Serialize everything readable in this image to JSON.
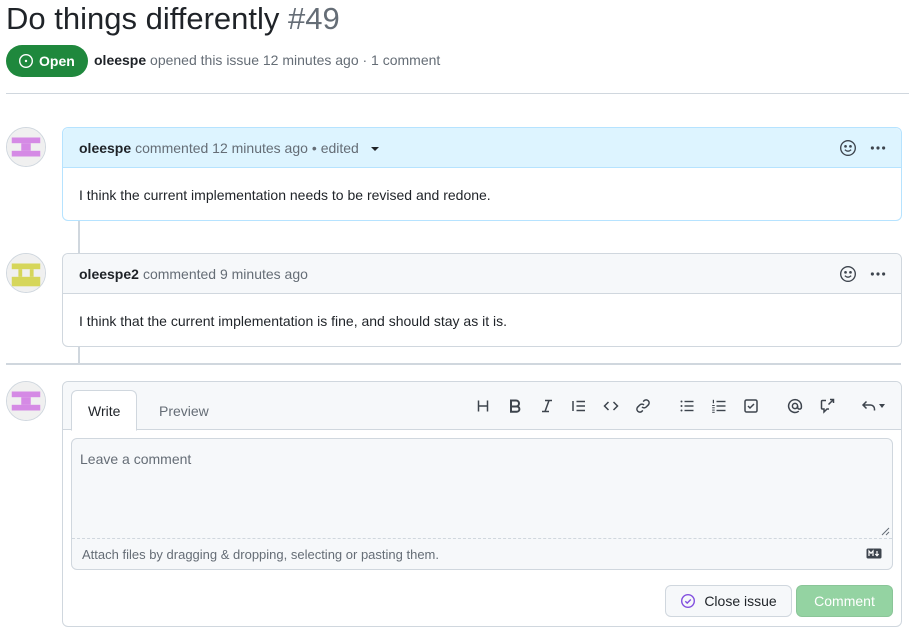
{
  "issue": {
    "title": "Do things differently",
    "number": "#49",
    "state": "Open",
    "author": "oleespe",
    "meta_text": "opened this issue 12 minutes ago · 1 comment"
  },
  "comments": [
    {
      "author": "oleespe",
      "action": "commented 12 minutes ago",
      "edited": "• edited",
      "body": "I think the current implementation needs to be revised and redone."
    },
    {
      "author": "oleespe2",
      "action": "commented 9 minutes ago",
      "body": "I think that the current implementation is fine, and should stay as it is."
    }
  ],
  "composer": {
    "tab_write": "Write",
    "tab_preview": "Preview",
    "placeholder": "Leave a comment",
    "attach_hint": "Attach files by dragging & dropping, selecting or pasting them.",
    "close_label": "Close issue",
    "comment_label": "Comment"
  },
  "toolbar_icons": [
    "heading-icon",
    "bold-icon",
    "italic-icon",
    "quote-icon",
    "code-icon",
    "link-icon",
    "bulleted-list-icon",
    "numbered-list-icon",
    "task-list-icon",
    "mention-icon",
    "cross-reference-icon",
    "reply-icon"
  ],
  "colors": {
    "open_green": "#1f883d",
    "author_header": "#ddf4ff",
    "comment_button_disabled": "#94d3a2",
    "avatar_purple": "#d58ae5",
    "avatar_yellow": "#d6d65a"
  }
}
